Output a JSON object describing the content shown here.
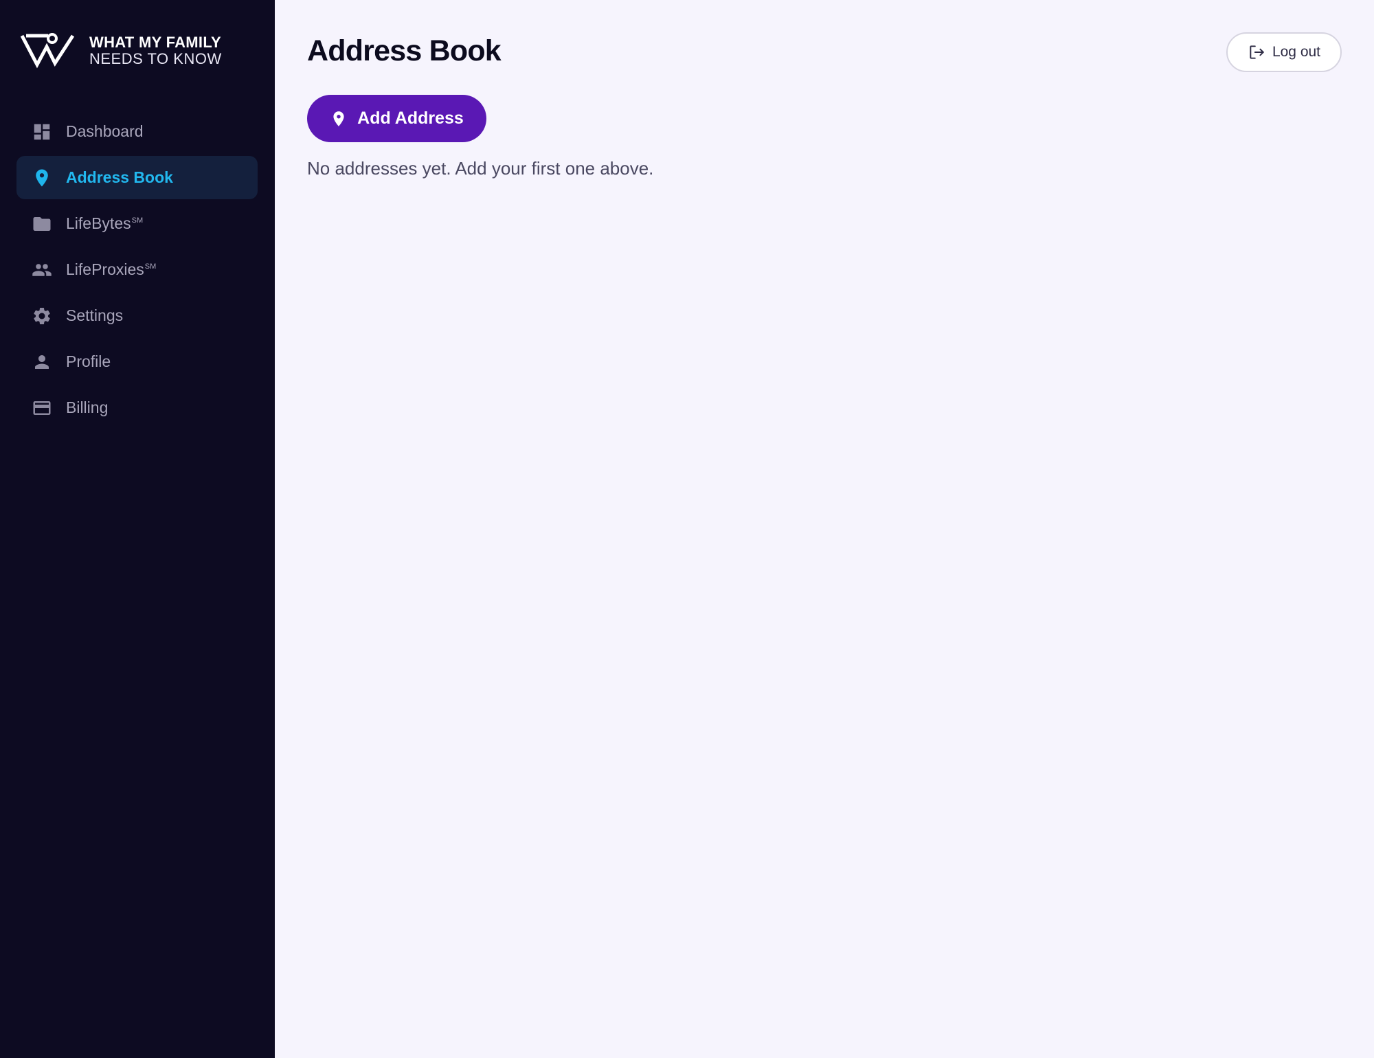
{
  "brand": {
    "line1": "WHAT MY FAMILY",
    "line2": "NEEDS TO KNOW"
  },
  "sidebar": {
    "items": [
      {
        "label": "Dashboard",
        "icon": "dashboard-icon",
        "active": false
      },
      {
        "label": "Address Book",
        "icon": "location-pin-icon",
        "active": true
      },
      {
        "label": "LifeBytes",
        "sup": "SM",
        "icon": "folder-icon",
        "active": false
      },
      {
        "label": "LifeProxies",
        "sup": "SM",
        "icon": "people-icon",
        "active": false
      },
      {
        "label": "Settings",
        "icon": "gear-icon",
        "active": false
      },
      {
        "label": "Profile",
        "icon": "person-icon",
        "active": false
      },
      {
        "label": "Billing",
        "icon": "credit-card-icon",
        "active": false
      }
    ]
  },
  "header": {
    "title": "Address Book",
    "logout_label": "Log out"
  },
  "main": {
    "add_button_label": "Add Address",
    "empty_message": "No addresses yet. Add your first one above."
  },
  "colors": {
    "sidebar_bg": "#0d0b22",
    "active_item_bg": "#14203d",
    "active_accent": "#22b8ef",
    "primary_button": "#5a18b4",
    "page_bg": "#f6f4fd"
  }
}
